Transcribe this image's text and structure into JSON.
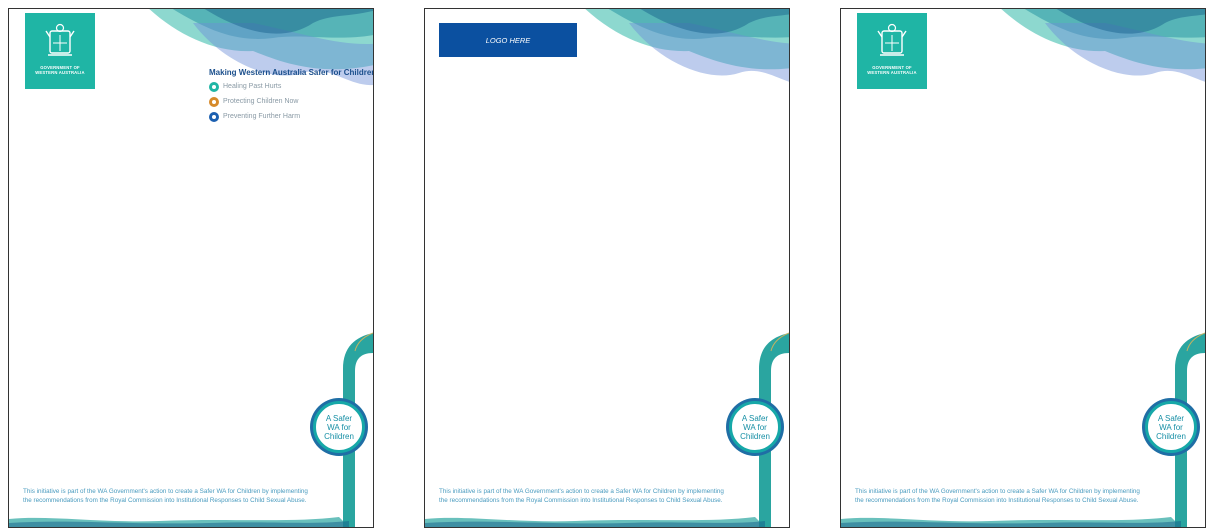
{
  "colors": {
    "teal": "#1fb5a5",
    "navy": "#0b50a0",
    "heading": "#1b4f8c",
    "footer_text": "#4a9bbf"
  },
  "gov_logo": {
    "line1": "GOVERNMENT OF",
    "line2": "WESTERN AUSTRALIA",
    "icon": "wa-crest-icon"
  },
  "placeholder_logo": "LOGO HERE",
  "tagline": {
    "title": "Making Western Australia Safer for Children",
    "items": [
      {
        "label": "Healing Past Hurts",
        "color": "#1fb5a5"
      },
      {
        "label": "Protecting Children Now",
        "color": "#d68a2a"
      },
      {
        "label": "Preventing Further Harm",
        "color": "#1b5fb0"
      }
    ]
  },
  "badge": {
    "line1": "A Safer",
    "line2": "WA for",
    "line3": "Children"
  },
  "footer": {
    "line1": "This initiative is part of the WA Government's action to create a Safer WA for Children by implementing",
    "line2": "the recommendations from the Royal Commission into Institutional Responses to Child Sexual Abuse."
  }
}
